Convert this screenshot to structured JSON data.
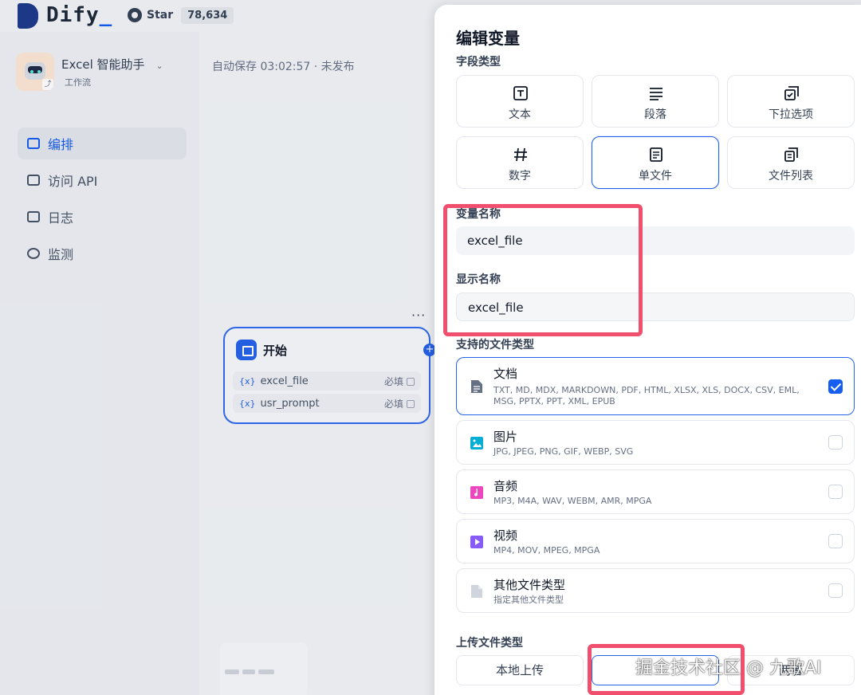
{
  "header": {
    "logo_text": "Dify",
    "logo_underscore": "_",
    "github_label": "Star",
    "github_count": "78,634"
  },
  "app": {
    "name": "Excel 智能助手",
    "type": "工作流"
  },
  "sidebar": {
    "items": [
      {
        "label": "编排",
        "icon": "layout-icon",
        "active": true
      },
      {
        "label": "访问 API",
        "icon": "terminal-icon",
        "active": false
      },
      {
        "label": "日志",
        "icon": "file-list-icon",
        "active": false
      },
      {
        "label": "监测",
        "icon": "gauge-icon",
        "active": false
      }
    ]
  },
  "canvas": {
    "status": "自动保存 03:02:57 · 未发布",
    "more": "···",
    "start_node": {
      "title": "开始",
      "vars": [
        {
          "brace": "{x}",
          "name": "excel_file",
          "required": "必填"
        },
        {
          "brace": "{x}",
          "name": "usr_prompt",
          "required": "必填"
        }
      ]
    }
  },
  "modal": {
    "title": "编辑变量",
    "field_type_label": "字段类型",
    "field_types": [
      {
        "label": "文本",
        "icon": "text-icon"
      },
      {
        "label": "段落",
        "icon": "paragraph-icon"
      },
      {
        "label": "下拉选项",
        "icon": "select-icon"
      },
      {
        "label": "数字",
        "icon": "number-icon"
      },
      {
        "label": "单文件",
        "icon": "single-file-icon",
        "selected": true
      },
      {
        "label": "文件列表",
        "icon": "file-list-icon"
      }
    ],
    "var_name_label": "变量名称",
    "var_name_value": "excel_file",
    "display_name_label": "显示名称",
    "display_name_value": "excel_file",
    "file_types_label": "支持的文件类型",
    "file_types": [
      {
        "name": "文档",
        "desc": "TXT, MD, MDX, MARKDOWN, PDF, HTML, XLSX, XLS, DOCX, CSV, EML, MSG, PPTX, PPT, XML, EPUB",
        "checked": true,
        "color": "#667085"
      },
      {
        "name": "图片",
        "desc": "JPG, JPEG, PNG, GIF, WEBP, SVG",
        "checked": false,
        "color": "#06aed4"
      },
      {
        "name": "音频",
        "desc": "MP3, M4A, WAV, WEBM, AMR, MPGA",
        "checked": false,
        "color": "#ee46bc"
      },
      {
        "name": "视频",
        "desc": "MP4, MOV, MPEG, MPGA",
        "checked": false,
        "color": "#875bf7"
      },
      {
        "name": "其他文件类型",
        "desc": "指定其他文件类型",
        "checked": false,
        "color": "#d0d5dd"
      }
    ],
    "upload_type_label": "上传文件类型",
    "upload_options": [
      {
        "label": "本地上传",
        "selected": false
      },
      {
        "label": "",
        "selected": true
      },
      {
        "label": "两者",
        "selected": false
      }
    ]
  },
  "watermark": "掘金技术社区 @ 九歌AI",
  "colors": {
    "accent": "#155eef",
    "highlight": "#f0506e",
    "node_border": "#2f6bf0"
  }
}
